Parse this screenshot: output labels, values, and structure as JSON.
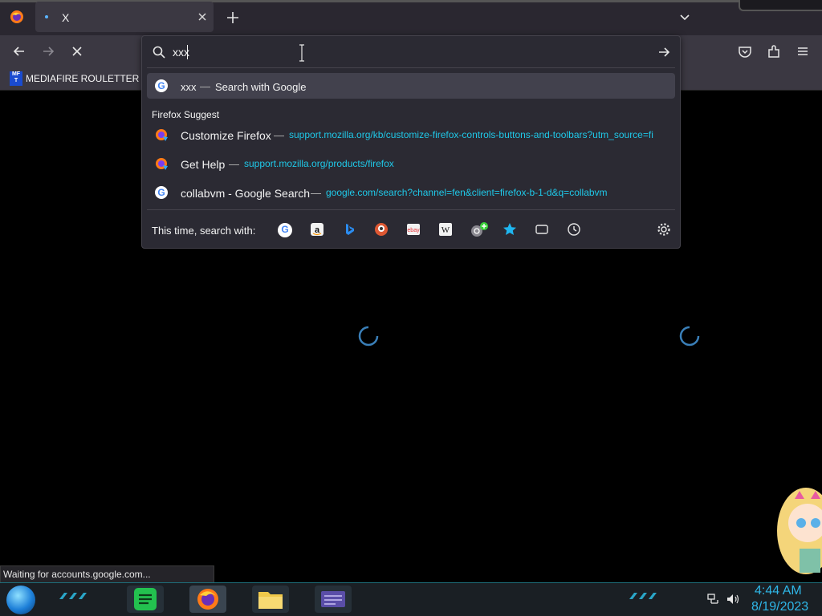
{
  "tab": {
    "title": "X"
  },
  "bookmarks": {
    "items": [
      {
        "label": "MEDIAFIRE ROULETTER",
        "icon_text": "MF T"
      }
    ]
  },
  "urlbar": {
    "value": "xxx"
  },
  "results": {
    "top": {
      "query": "xxx",
      "dash": "—",
      "action": "Search with Google"
    },
    "section_header": "Firefox Suggest",
    "items": [
      {
        "title": "Customize Firefox",
        "dash": "—",
        "url": "support.mozilla.org/kb/customize-firefox-controls-buttons-and-toolbars?utm_source=fi"
      },
      {
        "title": "Get Help",
        "dash": "—",
        "url": "support.mozilla.org/products/firefox"
      },
      {
        "title": "collabvm - Google Search",
        "dash": "—",
        "url": "google.com/search?channel=fen&client=firefox-b-1-d&q=collabvm"
      }
    ]
  },
  "search_with": {
    "label": "This time, search with:",
    "engines": [
      "google-icon",
      "amazon-icon",
      "bing-icon",
      "duckduckgo-icon",
      "ebay-icon",
      "wikipedia-icon",
      "add-search-icon",
      "bookmarks-icon",
      "tabs-icon",
      "history-icon"
    ]
  },
  "status": {
    "text": "Waiting for accounts.google.com..."
  },
  "clock": {
    "time": "4:44 AM",
    "date": "8/19/2023"
  },
  "colors": {
    "accent": "#1fc8e8",
    "clock": "#2fb7e8",
    "panel": "#2b2a33"
  }
}
